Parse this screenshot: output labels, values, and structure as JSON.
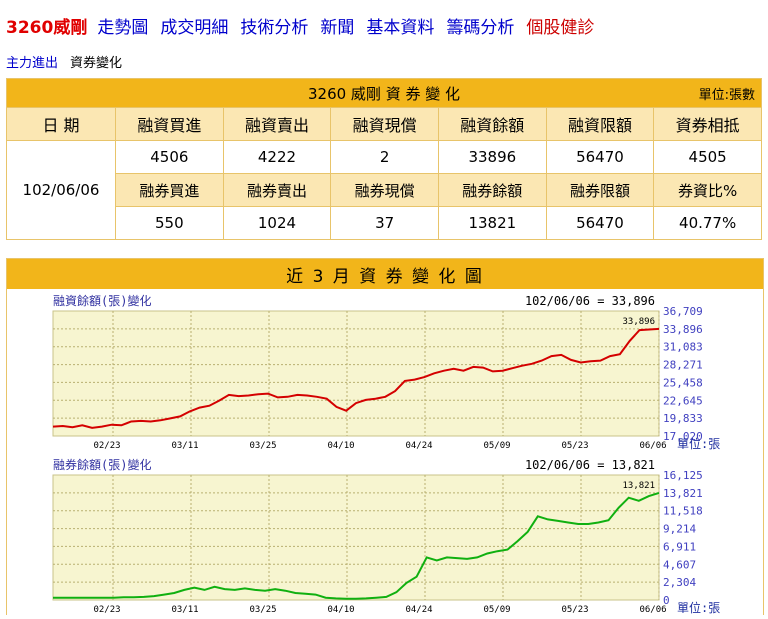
{
  "nav": {
    "stock": "3260威剛",
    "links": [
      "走勢圖",
      "成交明細",
      "技術分析",
      "新聞",
      "基本資料",
      "籌碼分析"
    ],
    "last": "個股健診"
  },
  "subnav": [
    "主力進出",
    "資券變化"
  ],
  "table": {
    "title": "3260 威剛 資 券 變 化",
    "unit": "單位:張數",
    "date_header": "日 期",
    "date": "102/06/06",
    "margin_headers": [
      "融資買進",
      "融資賣出",
      "融資現償",
      "融資餘額",
      "融資限額",
      "資券相抵"
    ],
    "margin_values": [
      "4506",
      "4222",
      "2",
      "33896",
      "56470",
      "4505"
    ],
    "short_headers": [
      "融券買進",
      "融券賣出",
      "融券現償",
      "融券餘額",
      "融券限額",
      "券資比%"
    ],
    "short_values": [
      "550",
      "1024",
      "37",
      "13821",
      "56470",
      "40.77%"
    ]
  },
  "chart_section": {
    "title": "近 3 月 資 券 變 化 圖"
  },
  "chart_data": [
    {
      "type": "line",
      "title": "融資餘額(張)變化",
      "summary": "102/06/06 = 33,896",
      "end_label": "33,896",
      "unit": "單位:張",
      "color": "#d40000",
      "x_ticks": [
        "02/23",
        "03/11",
        "03/25",
        "04/10",
        "04/24",
        "05/09",
        "05/23",
        "06/06"
      ],
      "y_ticks": [
        "36,709",
        "33,896",
        "31,083",
        "28,271",
        "25,458",
        "22,645",
        "19,833",
        "17,020"
      ],
      "ylim": [
        17020,
        36709
      ],
      "values": [
        18500,
        18600,
        18400,
        18700,
        18300,
        18500,
        18800,
        18700,
        19300,
        19400,
        19300,
        19500,
        19800,
        20100,
        20900,
        21500,
        21800,
        22600,
        23500,
        23300,
        23400,
        23600,
        23700,
        23100,
        23200,
        23500,
        23400,
        23200,
        22900,
        21600,
        21000,
        22200,
        22700,
        22900,
        23200,
        24100,
        25700,
        25900,
        26300,
        26900,
        27300,
        27600,
        27300,
        27900,
        27800,
        27200,
        27300,
        27700,
        28100,
        28400,
        28900,
        29600,
        29800,
        29000,
        28600,
        28800,
        28900,
        29600,
        29900,
        32000,
        33700,
        33800,
        33896
      ]
    },
    {
      "type": "line",
      "title": "融券餘額(張)變化",
      "summary": "102/06/06 = 13,821",
      "end_label": "13,821",
      "unit": "單位:張",
      "color": "#10b010",
      "x_ticks": [
        "02/23",
        "03/11",
        "03/25",
        "04/10",
        "04/24",
        "05/09",
        "05/23",
        "06/06"
      ],
      "y_ticks": [
        "16,125",
        "13,821",
        "11,518",
        "9,214",
        "6,911",
        "4,607",
        "2,304",
        "0"
      ],
      "ylim": [
        0,
        16125
      ],
      "values": [
        300,
        300,
        300,
        300,
        300,
        300,
        300,
        350,
        350,
        400,
        500,
        700,
        900,
        1300,
        1600,
        1300,
        1700,
        1400,
        1300,
        1500,
        1300,
        1200,
        1400,
        1200,
        900,
        800,
        700,
        300,
        200,
        150,
        150,
        200,
        300,
        400,
        1000,
        2200,
        3000,
        5500,
        5100,
        5500,
        5400,
        5300,
        5500,
        6000,
        6300,
        6500,
        7600,
        8800,
        10800,
        10400,
        10200,
        10000,
        9800,
        9800,
        10000,
        10300,
        11900,
        13200,
        12800,
        13400,
        13821
      ]
    }
  ]
}
